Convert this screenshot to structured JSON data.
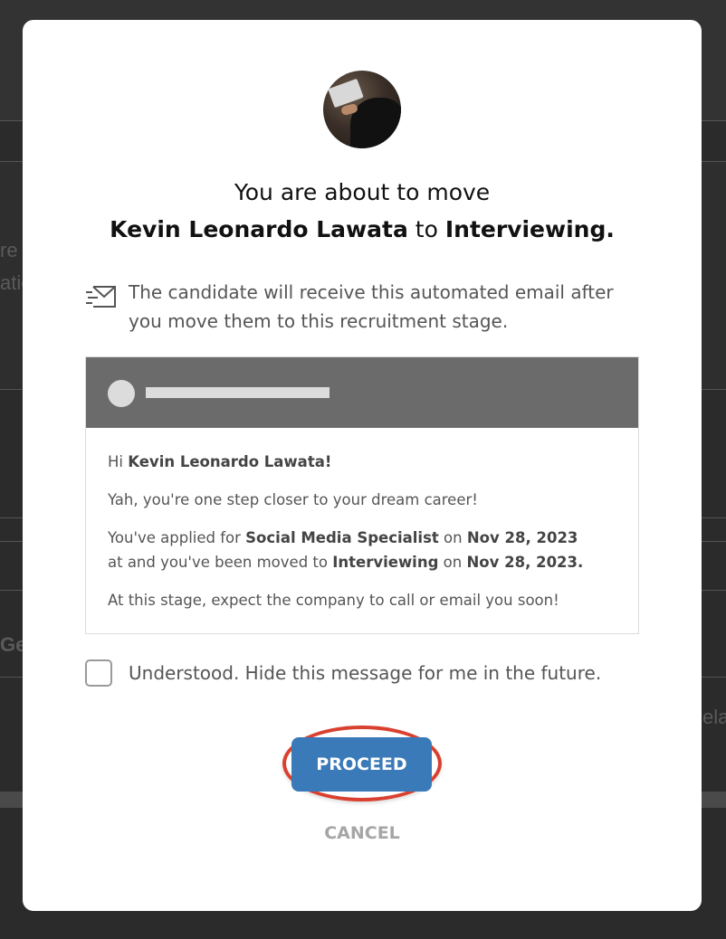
{
  "background": {
    "fragments": [
      "re j",
      "atic",
      "Ge",
      "ela"
    ]
  },
  "modal": {
    "title_line1": "You are about to move",
    "candidate_name": "Kevin Leonardo Lawata",
    "title_to": "to",
    "stage_name": "Interviewing.",
    "notice_text": "The candidate will receive this automated email after you move them to this recruitment stage.",
    "email": {
      "greeting_prefix": "Hi",
      "greeting_name": "Kevin Leonardo Lawata!",
      "line1": "Yah, you're one step closer to your dream career!",
      "line2_a": "You've applied for",
      "line2_job": "Social Media Specialist",
      "line2_on": "on",
      "line2_date": "Nov 28, 2023",
      "line3_a": "at and you've been moved to",
      "line3_stage": "Interviewing",
      "line3_on": "on",
      "line3_date": "Nov 28, 2023.",
      "line4": "At this stage, expect the company to call or email you soon!"
    },
    "checkbox_label": "Understood. Hide this message for me in the future.",
    "checkbox_checked": false,
    "proceed_label": "PROCEED",
    "cancel_label": "CANCEL"
  },
  "colors": {
    "primary_button": "#3b7ab8",
    "highlight_ring": "#d9402f",
    "email_header": "#6b6b6b",
    "overlay": "#2b2b2b"
  },
  "icons": {
    "notice": "mail-send-icon",
    "avatar": "user-photo"
  }
}
